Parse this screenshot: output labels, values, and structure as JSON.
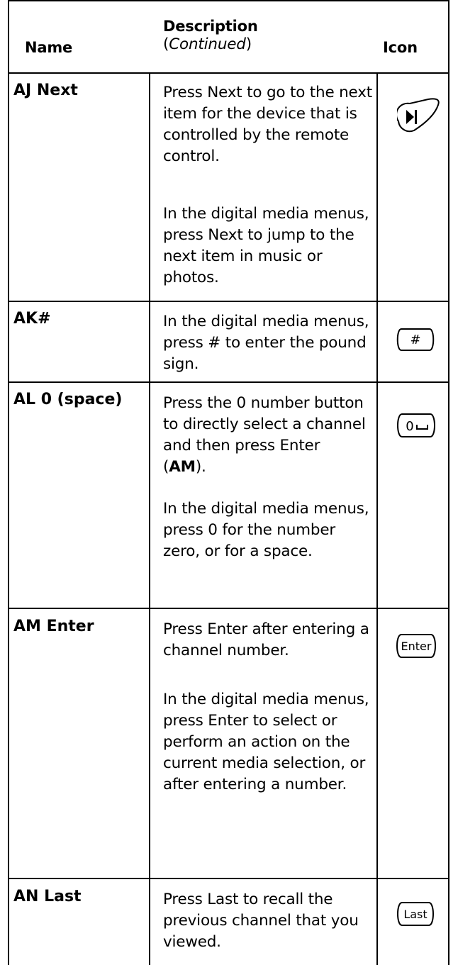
{
  "header": {
    "name": "Name",
    "description": "Description",
    "continued_open": "(",
    "continued": "Continued",
    "continued_close": ")",
    "icon": "Icon"
  },
  "rows": [
    {
      "name": "AJ Next",
      "paragraphs": [
        "Press Next to go to the next item for the device that is controlled by the remote control.",
        "In the digital media menus, press Next to jump to the next item in music or photos."
      ],
      "icon": "next-track-icon"
    },
    {
      "name": "AK#",
      "paragraphs": [
        "In the digital media menus, press # to enter the pound sign."
      ],
      "icon": "pound-button-icon",
      "icon_label": "#"
    },
    {
      "name": "AL 0 (space)",
      "paragraphs": [
        "Press the 0 number button to directly select a channel and then press Enter",
        "In the digital media menus, press 0 for the number zero, or for a space."
      ],
      "ref_open": "(",
      "ref_bold": "AM",
      "ref_close": ").",
      "icon": "zero-space-button-icon",
      "icon_label": "0"
    },
    {
      "name": "AM Enter",
      "paragraphs": [
        "Press Enter after entering a channel number.",
        "In the digital media menus, press Enter to select or perform an action on the current media selection, or after entering a number."
      ],
      "icon": "enter-button-icon",
      "icon_label": "Enter"
    },
    {
      "name": "AN Last",
      "paragraphs": [
        "Press Last to recall the previous channel that you viewed."
      ],
      "icon": "last-button-icon",
      "icon_label": "Last"
    }
  ]
}
